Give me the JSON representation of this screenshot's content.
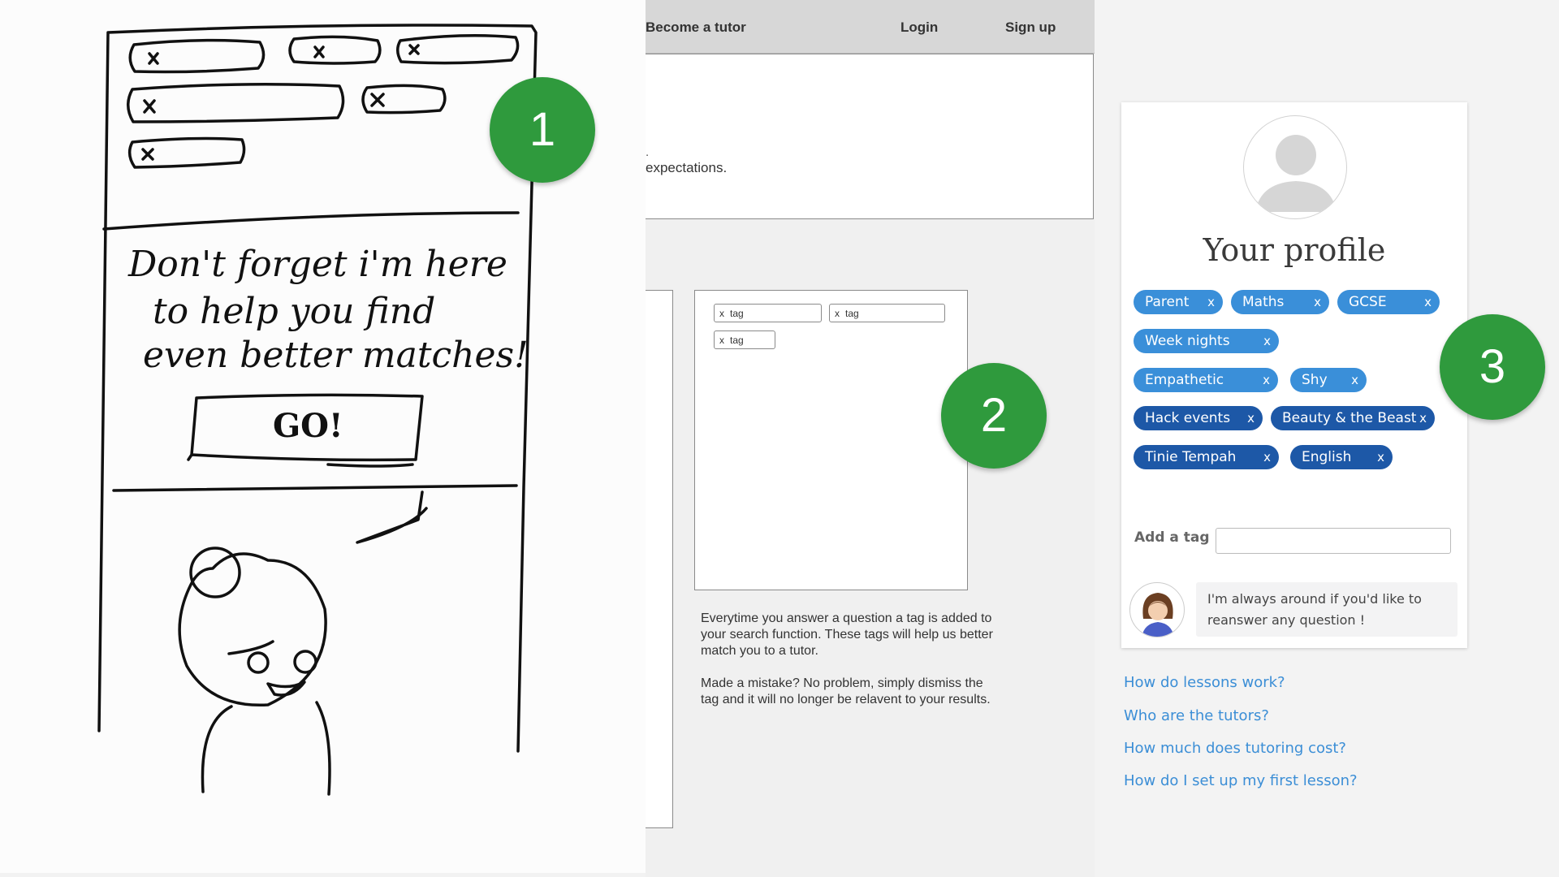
{
  "sketch": {
    "speech_lines": [
      "Don't forget i'm here",
      "to help you find",
      "even better matches!"
    ],
    "go_button": "GO!",
    "tag_x": "x"
  },
  "wireframe": {
    "nav": {
      "become_tutor": "Become a tutor",
      "login": "Login",
      "signup": "Sign up"
    },
    "hero_fragment": ".",
    "hero_text": "expectations.",
    "tags": [
      {
        "x": "x",
        "label": "tag"
      },
      {
        "x": "x",
        "label": "tag"
      },
      {
        "x": "x",
        "label": "tag"
      }
    ],
    "description_1": "Everytime you answer a question a tag is added to your search function. These tags will help us better match you to a tutor.",
    "description_2": "Made a mistake? No problem, simply dismiss the tag and it will no longer be relavent to your results."
  },
  "profile": {
    "title": "Your profile",
    "tags": [
      {
        "label": "Parent",
        "x": "x",
        "style": "light"
      },
      {
        "label": "Maths",
        "x": "x",
        "style": "light"
      },
      {
        "label": "GCSE",
        "x": "x",
        "style": "light"
      },
      {
        "label": "Week nights",
        "x": "x",
        "style": "light"
      },
      {
        "label": "Empathetic",
        "x": "x",
        "style": "light"
      },
      {
        "label": "Shy",
        "x": "x",
        "style": "light"
      },
      {
        "label": "Hack events",
        "x": "x",
        "style": "dark"
      },
      {
        "label": "Beauty & the Beast",
        "x": "x",
        "style": "dark"
      },
      {
        "label": "Tinie Tempah",
        "x": "x",
        "style": "dark"
      },
      {
        "label": "English",
        "x": "x",
        "style": "dark"
      }
    ],
    "add_tag_label": "Add a tag",
    "add_tag_value": "",
    "speech_line_1": "I'm always around if you'd like to",
    "speech_line_2": "reanswer any question !",
    "faq_links": [
      "How do lessons work?",
      "Who are the tutors?",
      "How much does tutoring cost?",
      "How do I set up my first lesson?"
    ]
  },
  "badges": [
    "1",
    "2",
    "3"
  ],
  "colors": {
    "badge_green": "#2f9a3d",
    "tag_light_blue": "#3a8fd9",
    "tag_dark_blue": "#1d58a7",
    "link_blue": "#3b8ed6"
  }
}
